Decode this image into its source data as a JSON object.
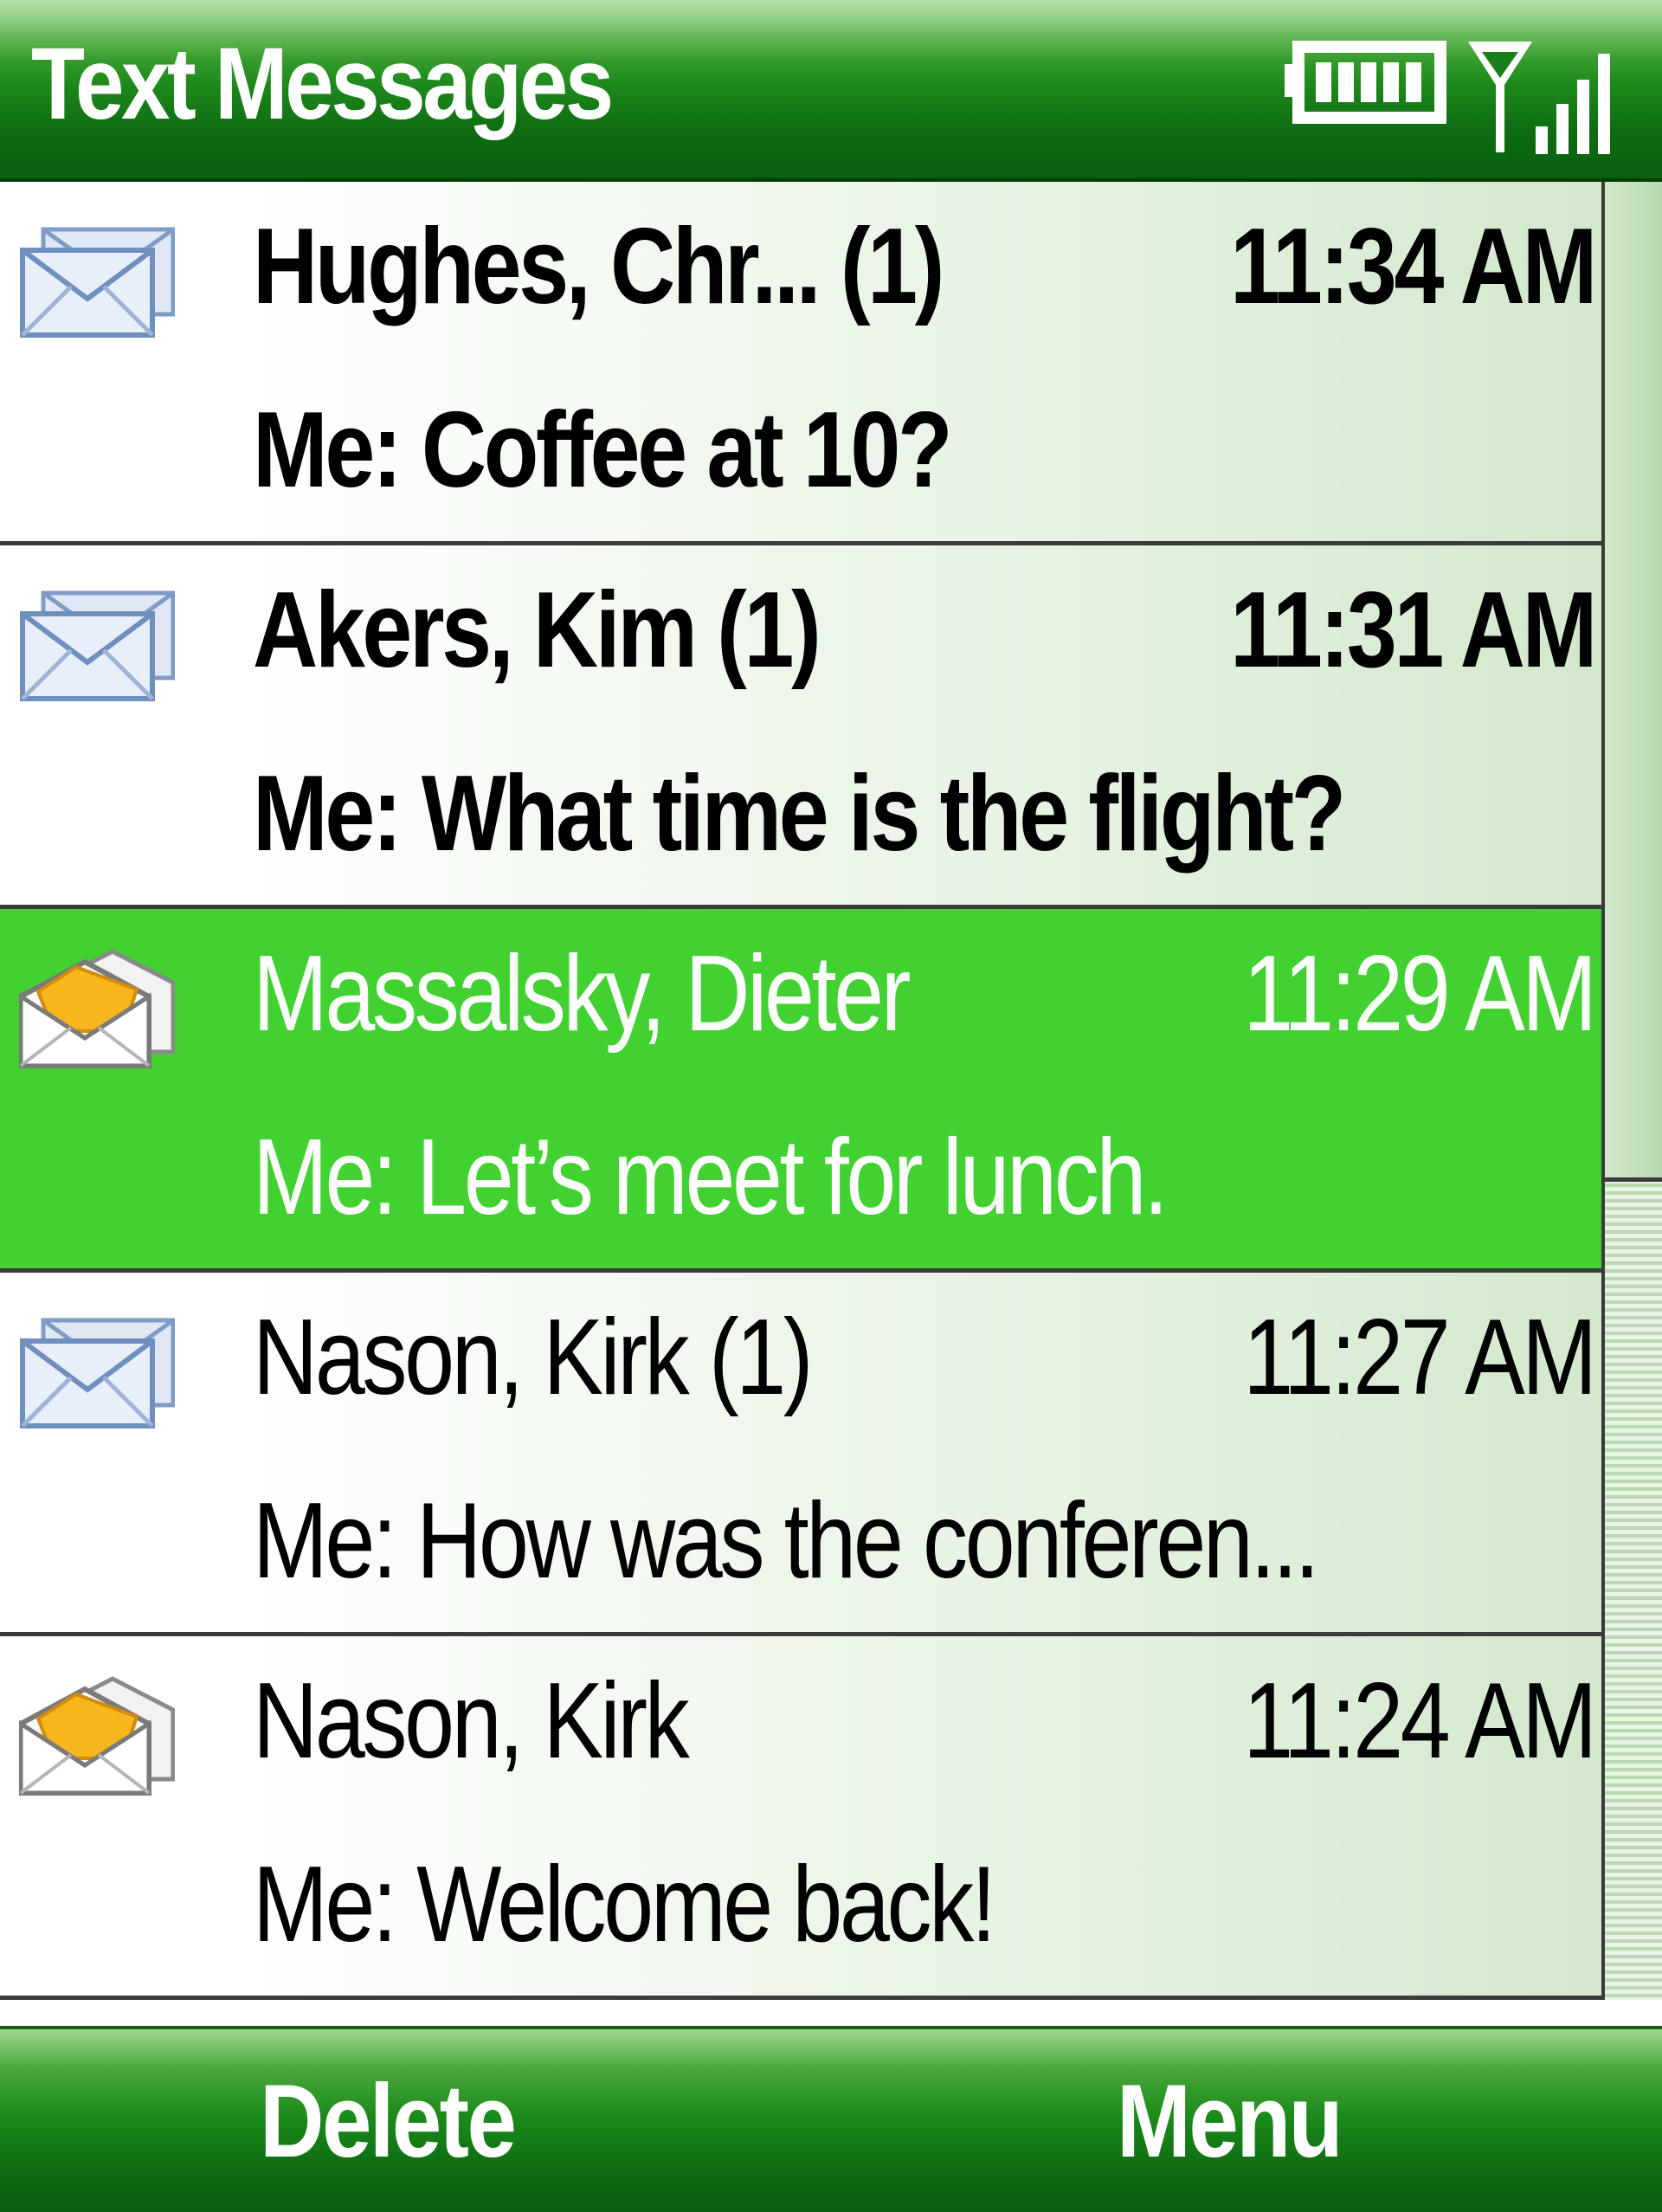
{
  "window": {
    "title": "Text Messages"
  },
  "status": {
    "battery_icon": "battery-icon",
    "signal_icon": "signal-strength-icon",
    "battery_level": 1.0,
    "signal_bars": 4
  },
  "colors": {
    "selection": "#41d232",
    "bar_green": "#0e6d12",
    "text": "#000000",
    "selected_text": "#ffffff"
  },
  "messages": [
    {
      "sender": "Hughes, Chr... (1)",
      "time": "11:34 AM",
      "preview": "Me: Coffee at 10?",
      "unread": true,
      "selected": false,
      "icon": "closed-envelope-icon"
    },
    {
      "sender": "Akers, Kim (1)",
      "time": "11:31 AM",
      "preview": "Me: What time is the flight?",
      "unread": true,
      "selected": false,
      "icon": "closed-envelope-icon"
    },
    {
      "sender": "Massalsky, Dieter",
      "time": "11:29 AM",
      "preview": "Me: Let’s meet for lunch.",
      "unread": false,
      "selected": true,
      "icon": "open-envelope-icon"
    },
    {
      "sender": "Nason, Kirk (1)",
      "time": "11:27 AM",
      "preview": "Me: How was the conferen...",
      "unread": false,
      "selected": false,
      "icon": "closed-envelope-icon"
    },
    {
      "sender": "Nason, Kirk",
      "time": "11:24 AM",
      "preview": "Me: Welcome back!",
      "unread": false,
      "selected": false,
      "icon": "open-envelope-icon"
    }
  ],
  "softkeys": {
    "left": "Delete",
    "right": "Menu"
  },
  "scroll": {
    "position": 0,
    "visible_fraction": 0.55
  }
}
